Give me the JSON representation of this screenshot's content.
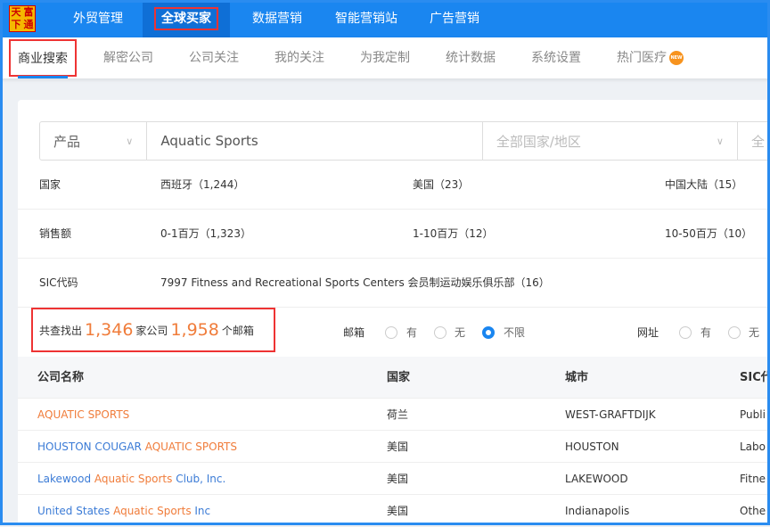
{
  "logo": [
    "天",
    "富",
    "下",
    "通"
  ],
  "topnav": [
    "外贸管理",
    "全球买家",
    "数据营销",
    "智能营销站",
    "广告营销"
  ],
  "subnav": [
    "商业搜索",
    "解密公司",
    "公司关注",
    "我的关注",
    "为我定制",
    "统计数据",
    "系统设置",
    "热门医疗"
  ],
  "new_badge": "NEW",
  "search": {
    "type": "产品",
    "query": "Aquatic Sports",
    "country_placeholder": "全部国家/地区",
    "next": "全"
  },
  "filters": [
    {
      "label": "国家",
      "options": [
        "西班牙（1,244）",
        "美国（23）",
        "中国大陆（15）"
      ]
    },
    {
      "label": "销售额",
      "options": [
        "0-1百万（1,323）",
        "1-10百万（12）",
        "10-50百万（10）"
      ]
    },
    {
      "label": "SIC代码",
      "options": [
        "7997 Fitness and Recreational Sports Centers 会员制运动娱乐俱乐部（16）"
      ]
    }
  ],
  "result": {
    "prefix": "共查找出",
    "companies": "1,346",
    "mid": "家公司",
    "emails": "1,958",
    "suffix": "个邮箱",
    "email_label": "邮箱",
    "yes": "有",
    "no": "无",
    "any": "不限",
    "email_selected": "不限",
    "web_label": "网址"
  },
  "table": {
    "headers": [
      "公司名称",
      "国家",
      "城市",
      "SIC代"
    ],
    "rows": [
      {
        "name_pre": "",
        "name_hit": "AQUATIC SPORTS",
        "name_post": "",
        "country": "荷兰",
        "city": "WEST-GRAFTDIJK",
        "sic": "Publi"
      },
      {
        "name_pre": "HOUSTON COUGAR ",
        "name_hit": "AQUATIC SPORTS",
        "name_post": "",
        "country": "美国",
        "city": "HOUSTON",
        "sic": "Labo"
      },
      {
        "name_pre": "Lakewood ",
        "name_hit": "Aquatic Sports",
        "name_post": " Club, Inc.",
        "country": "美国",
        "city": "LAKEWOOD",
        "sic": "Fitne"
      },
      {
        "name_pre": "United States ",
        "name_hit": "Aquatic Sports",
        "name_post": " Inc",
        "country": "美国",
        "city": "Indianapolis",
        "sic": "Othe"
      }
    ]
  },
  "colors": {
    "brand": "#1a86f0",
    "highlight": "#f07c3a",
    "link": "#3b7bd6"
  }
}
